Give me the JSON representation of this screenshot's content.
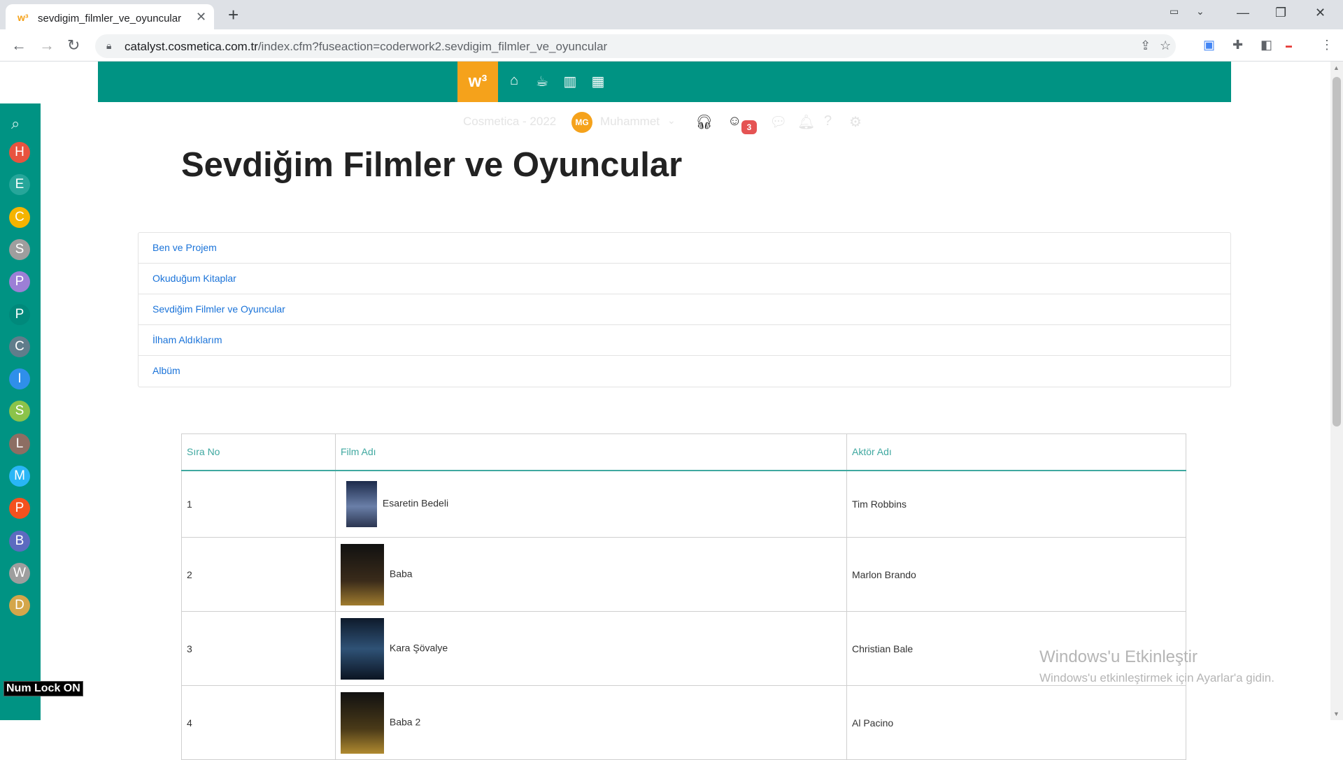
{
  "browser": {
    "tab_title": "sevdigim_filmler_ve_oyuncular",
    "tab_favicon": "w³",
    "url_host": "catalyst.cosmetica.com.tr",
    "url_path": "/index.cfm?fuseaction=coderwork2.sevdigim_filmler_ve_oyuncular"
  },
  "topbar": {
    "logo": "w³",
    "icons": [
      "home-icon",
      "coffee-icon",
      "chart-icon",
      "calendar-icon"
    ],
    "accent": "#009383",
    "logo_color": "#f5a21b"
  },
  "userbar": {
    "company": "Cosmetica - 2022",
    "avatar_initials": "MG",
    "username": "Muhammet",
    "badge_count": "3"
  },
  "sidebar": {
    "items": [
      {
        "letter": "H",
        "color": "#e8533f"
      },
      {
        "letter": "E",
        "color": "#26a69a"
      },
      {
        "letter": "C",
        "color": "#f5b400"
      },
      {
        "letter": "S",
        "color": "#9e9e9e"
      },
      {
        "letter": "P",
        "color": "#9c7fd6"
      },
      {
        "letter": "P",
        "color": "#00897b"
      },
      {
        "letter": "C",
        "color": "#607d8b"
      },
      {
        "letter": "I",
        "color": "#2f8fea"
      },
      {
        "letter": "S",
        "color": "#8bc34a"
      },
      {
        "letter": "L",
        "color": "#8d6e63"
      },
      {
        "letter": "M",
        "color": "#29b6f6"
      },
      {
        "letter": "P",
        "color": "#f4511e"
      },
      {
        "letter": "B",
        "color": "#5c6bc0"
      },
      {
        "letter": "W",
        "color": "#9e9e9e"
      },
      {
        "letter": "D",
        "color": "#d4a64a"
      }
    ]
  },
  "page": {
    "title": "Sevdiğim Filmler ve Oyuncular"
  },
  "menu": {
    "items": [
      "Ben ve Projem",
      "Okuduğum Kitaplar",
      "Sevdiğim Filmler ve Oyuncular",
      "İlham Aldıklarım",
      "Albüm"
    ]
  },
  "table": {
    "headers": [
      "Sıra No",
      "Film Adı",
      "Aktör Adı"
    ],
    "rows": [
      {
        "no": "1",
        "film": "Esaretin Bedeli",
        "actor": "Tim Robbins"
      },
      {
        "no": "2",
        "film": "Baba",
        "actor": "Marlon Brando"
      },
      {
        "no": "3",
        "film": "Kara Şövalye",
        "actor": "Christian Bale"
      },
      {
        "no": "4",
        "film": "Baba 2",
        "actor": "Al Pacino"
      }
    ]
  },
  "status": {
    "numlock": "Num Lock ON",
    "watermark_title": "Windows'u Etkinleştir",
    "watermark_sub": "Windows'u etkinleştirmek için Ayarlar'a gidin."
  }
}
